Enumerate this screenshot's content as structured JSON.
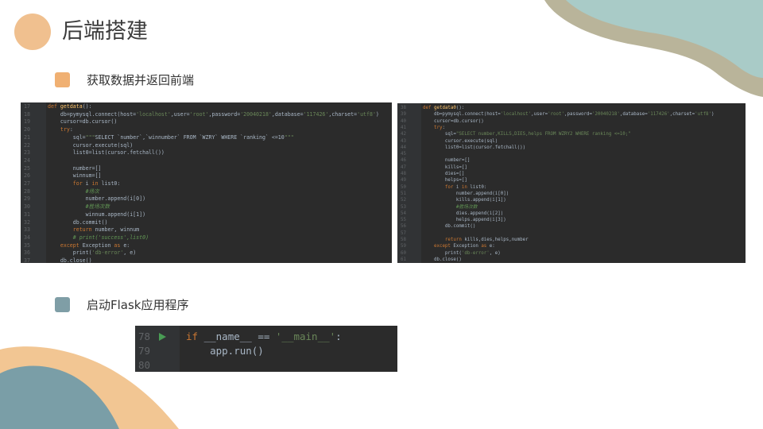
{
  "page": {
    "title": "后端搭建"
  },
  "sections": [
    {
      "label": "获取数据并返回前端",
      "color": "#f0b072"
    },
    {
      "label": "启动Flask应用程序",
      "color": "#7f9ea6"
    }
  ],
  "code_left": {
    "lines": [
      {
        "n": "17",
        "t": "def getdata():"
      },
      {
        "n": "18",
        "t": "    db=pymysql.connect(host='localhost',user='root',password='20040218',database='117426',charset='utf8')"
      },
      {
        "n": "19",
        "t": "    cursor=db.cursor()"
      },
      {
        "n": "20",
        "t": "    try:"
      },
      {
        "n": "21",
        "t": "        sql=\"\"\"SELECT `number`,`winnumber` FROM `WZRY` WHERE `ranking` <=10\"\"\""
      },
      {
        "n": "22",
        "t": "        cursor.execute(sql)"
      },
      {
        "n": "23",
        "t": "        list0=list(cursor.fetchall())"
      },
      {
        "n": "24",
        "t": ""
      },
      {
        "n": "25",
        "t": "        number=[]"
      },
      {
        "n": "26",
        "t": "        winnum=[]"
      },
      {
        "n": "27",
        "t": "        for i in list0:"
      },
      {
        "n": "28",
        "t": "            #场次"
      },
      {
        "n": "29",
        "t": "            number.append(i[0])"
      },
      {
        "n": "30",
        "t": "            #胜场次数"
      },
      {
        "n": "31",
        "t": "            winnum.append(i[1])"
      },
      {
        "n": "32",
        "t": "        db.commit()"
      },
      {
        "n": "33",
        "t": "        return number, winnum"
      },
      {
        "n": "34",
        "t": "        # print('success',list0)"
      },
      {
        "n": "35",
        "t": "    except Exception as e:"
      },
      {
        "n": "36",
        "t": "        print('db-error', e)"
      },
      {
        "n": "37",
        "t": "    db.close()"
      }
    ]
  },
  "code_right": {
    "lines": [
      {
        "n": "38",
        "t": "def getdata0():"
      },
      {
        "n": "39",
        "t": "    db=pymysql.connect(host='localhost',user='root',password='20040218',database='117426',charset='utf8')"
      },
      {
        "n": "40",
        "t": "    cursor=db.cursor()"
      },
      {
        "n": "41",
        "t": "    try:"
      },
      {
        "n": "42",
        "t": "        sql=\"SELECT number,KILLS,DIES,helps FROM WZRY2 WHERE ranking <=10;\""
      },
      {
        "n": "43",
        "t": "        cursor.execute(sql)"
      },
      {
        "n": "44",
        "t": "        list0=list(cursor.fetchall())"
      },
      {
        "n": "45",
        "t": ""
      },
      {
        "n": "46",
        "t": "        number=[]"
      },
      {
        "n": "47",
        "t": "        kills=[]"
      },
      {
        "n": "48",
        "t": "        dies=[]"
      },
      {
        "n": "49",
        "t": "        helps=[]"
      },
      {
        "n": "50",
        "t": "        for i in list0:"
      },
      {
        "n": "51",
        "t": "            number.append(i[0])"
      },
      {
        "n": "52",
        "t": "            kills.append(i[1])"
      },
      {
        "n": "53",
        "t": "            #胜场次数"
      },
      {
        "n": "54",
        "t": "            dies.append(i[2])"
      },
      {
        "n": "55",
        "t": "            helps.append(i[3])"
      },
      {
        "n": "56",
        "t": "        db.commit()"
      },
      {
        "n": "57",
        "t": ""
      },
      {
        "n": "58",
        "t": "        return kills,dies,helps,number"
      },
      {
        "n": "59",
        "t": "    except Exception as e:"
      },
      {
        "n": "60",
        "t": "        print('db-error', e)"
      },
      {
        "n": "61",
        "t": "    db.close()"
      }
    ]
  },
  "code_bottom": {
    "lines": [
      {
        "n": "78",
        "t": "if __name__ == '__main__':"
      },
      {
        "n": "79",
        "t": "    app.run()"
      },
      {
        "n": "80",
        "t": ""
      }
    ]
  },
  "theme": {
    "accent_orange": "#f0c08f",
    "accent_teal": "#8fb8b5",
    "editor_bg": "#2b2b2b"
  }
}
